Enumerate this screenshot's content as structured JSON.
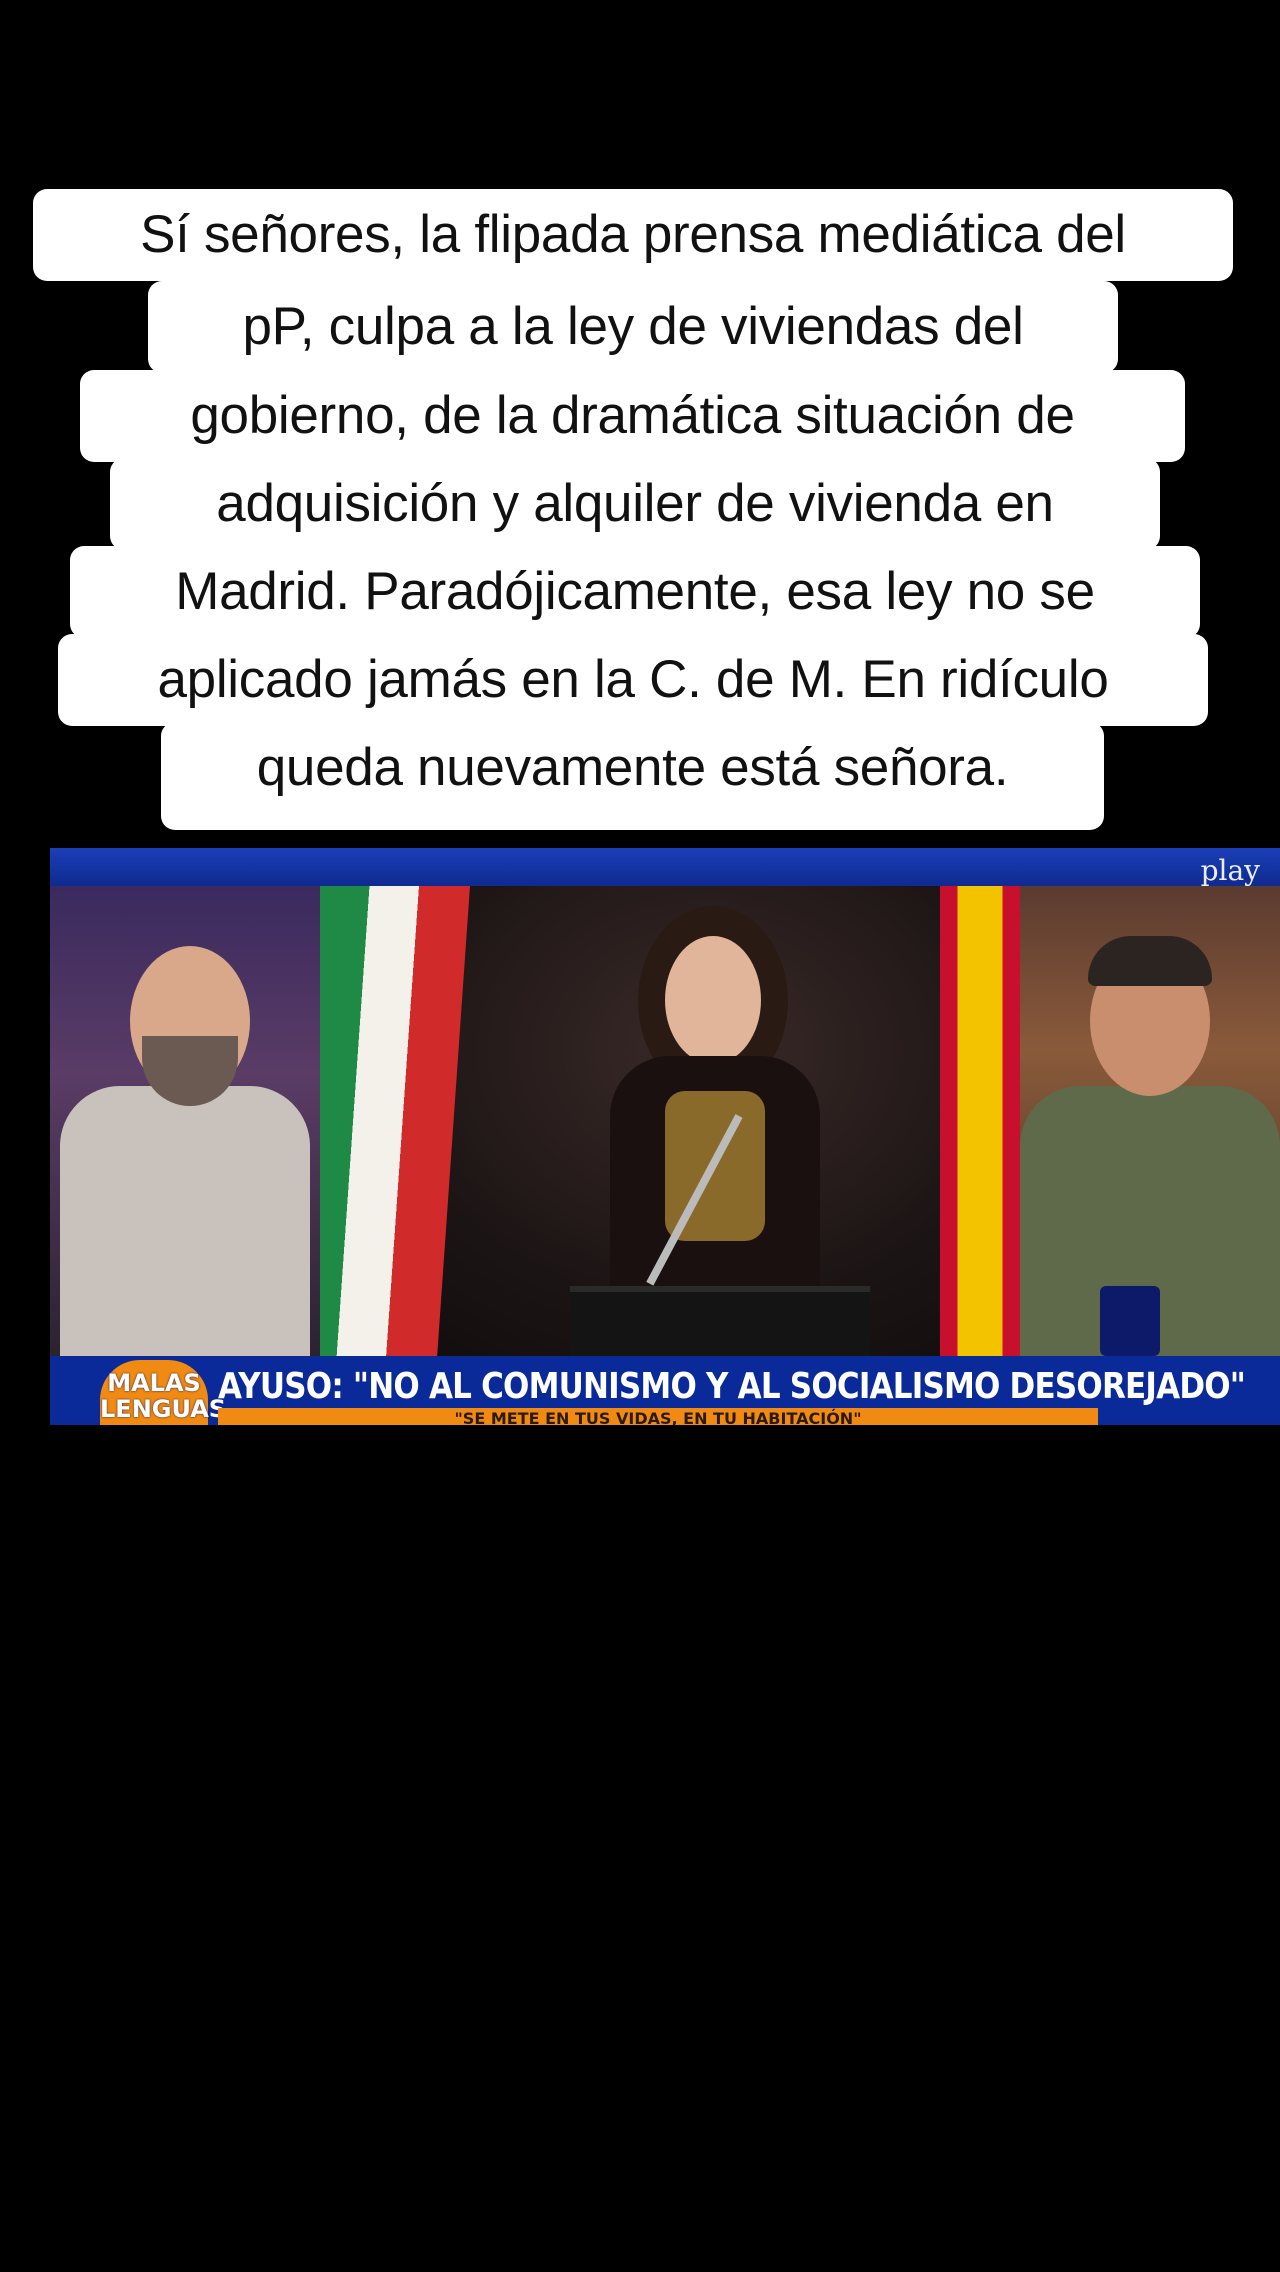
{
  "caption": {
    "lines": [
      "Sí señores, la flipada prensa mediática del",
      "pP, culpa a la ley de viviendas del",
      "gobierno, de la dramática situación de",
      "adquisición y alquiler de vivienda en",
      "Madrid. Paradójicamente, esa ley no se",
      "aplicado jamás en la C. de M. En ridículo",
      "queda nuevamente está señora."
    ]
  },
  "video": {
    "channel_logo": "play",
    "show_logo": {
      "line1": "MALAS",
      "line2": "LENGUAS"
    },
    "headline": "AYUSO: \"NO AL COMUNISMO Y AL SOCIALISMO DESOREJADO\"",
    "subheadline": "\"SE METE EN TUS VIDAS, EN TU HABITACIÓN\"",
    "colors": {
      "lower_third_bg": "#0a2a9a",
      "accent_orange": "#f08a12",
      "top_bar": "#1b3fb8"
    }
  }
}
